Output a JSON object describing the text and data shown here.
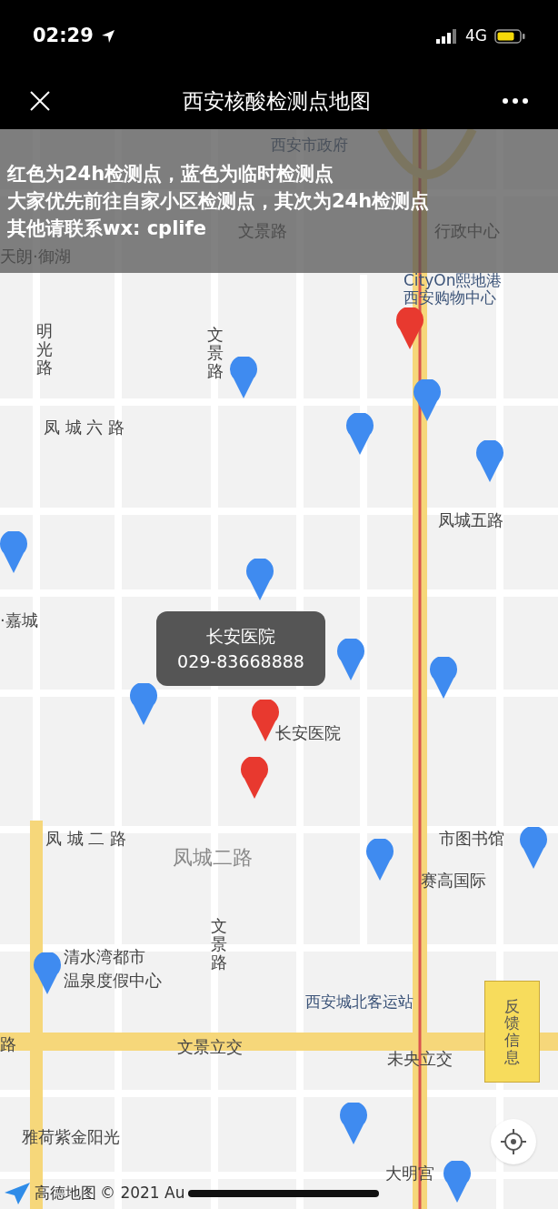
{
  "status_bar": {
    "time": "02:29",
    "network": "4G"
  },
  "nav": {
    "title": "西安核酸检测点地图"
  },
  "notice": {
    "lines": [
      "红色为24h检测点，蓝色为临时检测点",
      "大家优先前往自家小区检测点，其次为24h检测点",
      "其他请联系wx: cplife"
    ]
  },
  "map_labels": [
    {
      "text": "西安市政府",
      "kind": "poi"
    },
    {
      "text": "文景路",
      "kind": "road"
    },
    {
      "text": "行政中心",
      "kind": "road"
    },
    {
      "text": "天朗·御湖",
      "kind": "road"
    },
    {
      "text": "CityOn熙地港",
      "kind": "poi"
    },
    {
      "text": "西安购物中心",
      "kind": "poi"
    },
    {
      "text": "明光路",
      "kind": "vroad"
    },
    {
      "text": "文景路",
      "kind": "vroad"
    },
    {
      "text": "凤 城 六 路",
      "kind": "road"
    },
    {
      "text": "凤城五路",
      "kind": "road"
    },
    {
      "text": "·嘉城",
      "kind": "road"
    },
    {
      "text": "长安医院",
      "kind": "road"
    },
    {
      "text": "凤 城 二 路",
      "kind": "road"
    },
    {
      "text": "凤城二路",
      "kind": "faint"
    },
    {
      "text": "市图书馆",
      "kind": "road"
    },
    {
      "text": "赛高国际",
      "kind": "road"
    },
    {
      "text": "文景路",
      "kind": "vroad"
    },
    {
      "text": "清水湾都市",
      "kind": "road"
    },
    {
      "text": "温泉度假中心",
      "kind": "road"
    },
    {
      "text": "西安城北客运站",
      "kind": "poi"
    },
    {
      "text": "路",
      "kind": "road"
    },
    {
      "text": "文景立交",
      "kind": "road"
    },
    {
      "text": "未央立交",
      "kind": "road"
    },
    {
      "text": "雅荷紫金阳光",
      "kind": "road"
    },
    {
      "text": "大明宫",
      "kind": "road"
    }
  ],
  "pins": [
    {
      "color": "#e8392f"
    },
    {
      "color": "#3f8bf0"
    },
    {
      "color": "#3f8bf0"
    },
    {
      "color": "#3f8bf0"
    },
    {
      "color": "#3f8bf0"
    },
    {
      "color": "#3f8bf0"
    },
    {
      "color": "#3f8bf0"
    },
    {
      "color": "#3f8bf0"
    },
    {
      "color": "#3f8bf0"
    },
    {
      "color": "#3f8bf0"
    },
    {
      "color": "#e8392f"
    },
    {
      "color": "#e8392f"
    },
    {
      "color": "#3f8bf0"
    },
    {
      "color": "#3f8bf0"
    },
    {
      "color": "#3f8bf0"
    },
    {
      "color": "#3f8bf0"
    },
    {
      "color": "#3f8bf0"
    }
  ],
  "callout": {
    "name": "长安医院",
    "phone": "029-83668888"
  },
  "feedback_button": {
    "label": "反馈信息"
  },
  "attribution": {
    "brand": "高德地图",
    "copyright": "© 2021 Au"
  }
}
